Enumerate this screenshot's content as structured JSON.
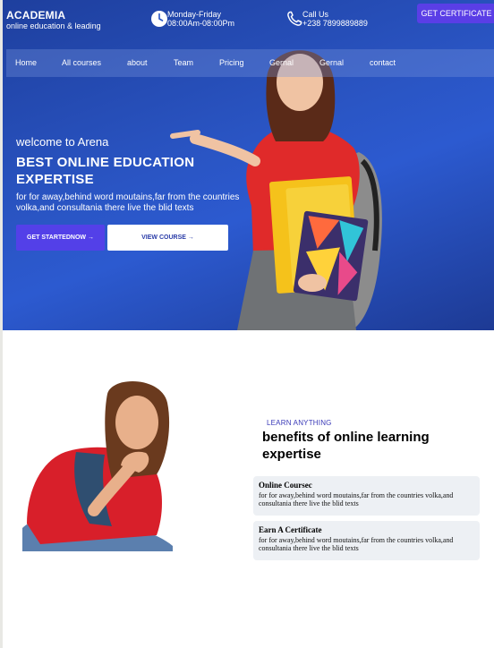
{
  "brand": {
    "name": "ACADEMIA",
    "tagline": "online education & leading"
  },
  "header": {
    "hours": {
      "line1": "Monday-Friday",
      "line2": "08:00Am-08:00Pm"
    },
    "call": {
      "line1": "Call Us",
      "line2": "+238 7899889889"
    },
    "socials": [
      "facebook-icon",
      "x-icon",
      "instagram-icon",
      "tiktok-icon"
    ]
  },
  "nav": {
    "items": [
      "Home",
      "All courses",
      "about",
      "Team",
      "Pricing",
      "Gernal",
      "Gernal",
      "contact"
    ],
    "cta": "GET CERTIFICATE"
  },
  "hero": {
    "welcome": "welcome to Arena",
    "headline": "BEST ONLINE EDUCATION EXPERTISE",
    "subtext": "for for away,behind word moutains,far from the countries volka,and consultania there live the blid texts",
    "primary_button": "GET STARTEDNOW →",
    "secondary_button": "VIEW COURSE →"
  },
  "benefits": {
    "eyebrow": "LEARN ANYTHING",
    "title": "benefits of online learning expertise",
    "cards": [
      {
        "title": "Online Coursec",
        "text": "for for away,behind word moutains,far from the countries volka,and consultania there live the blid texts"
      },
      {
        "title": "Earn A Certificate",
        "text": "for for away,behind word moutains,far from the countries volka,and consultania there live the blid texts"
      }
    ]
  },
  "colors": {
    "hero_blue": "#2a55c4",
    "accent_purple": "#5340e8"
  }
}
